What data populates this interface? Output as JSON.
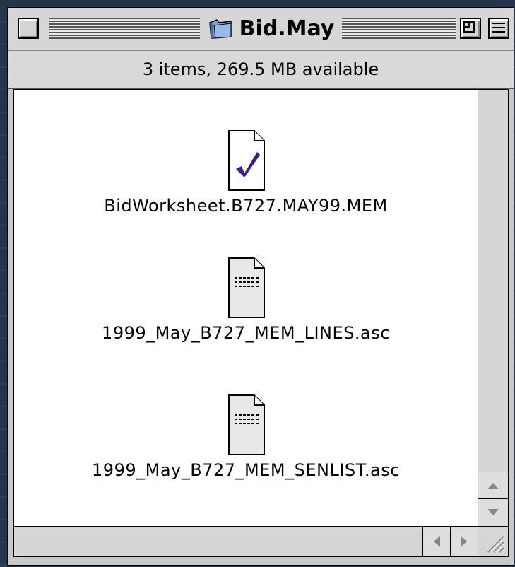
{
  "window": {
    "title": "Bid.May",
    "info": "3 items, 269.5 MB available"
  },
  "files": [
    {
      "name": "BidWorksheet.B727.MAY99.MEM",
      "icon": "checkmark-document-icon"
    },
    {
      "name": "1999_May_B727_MEM_LINES.asc",
      "icon": "text-document-icon"
    },
    {
      "name": "1999_May_B727_MEM_SENLIST.asc",
      "icon": "text-document-icon"
    }
  ],
  "colors": {
    "checkmark": "#3c1a8c",
    "folder": "#7fa0d8"
  }
}
